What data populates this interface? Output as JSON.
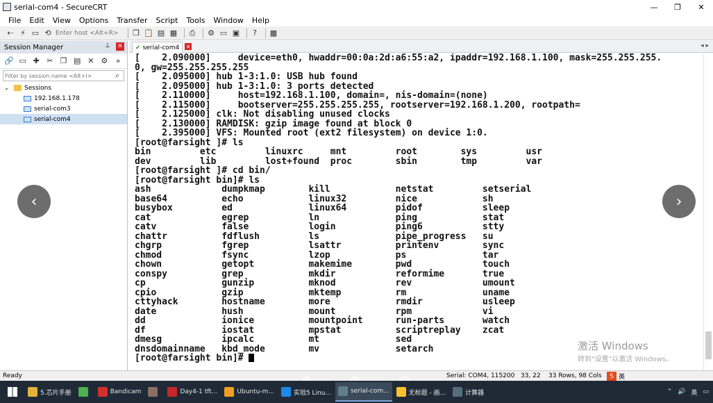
{
  "window": {
    "title": "serial-com4 - SecureCRT",
    "controls": [
      "—",
      "❐",
      "✕"
    ]
  },
  "menu": [
    "File",
    "Edit",
    "View",
    "Options",
    "Transfer",
    "Script",
    "Tools",
    "Window",
    "Help"
  ],
  "toolbar": {
    "host_placeholder": "Enter host <Alt+R>"
  },
  "session_manager": {
    "title": "Session Manager",
    "pin": "ᵽ",
    "filter_placeholder": "Filter by session name <Alt+I>",
    "root": "Sessions",
    "items": [
      {
        "label": "192.168.1.178",
        "selected": false
      },
      {
        "label": "serial-com3",
        "selected": false
      },
      {
        "label": "serial-com4",
        "selected": true
      }
    ]
  },
  "tab": {
    "label": "serial-com4"
  },
  "terminal": {
    "lines": [
      "[    2.090000]     device=eth0, hwaddr=00:0a:2d:a6:55:a2, ipaddr=192.168.1.100, mask=255.255.255.",
      "0, gw=255.255.255.255",
      "[    2.095000] hub 1-3:1.0: USB hub found",
      "[    2.095000] hub 1-3:1.0: 3 ports detected",
      "[    2.110000]     host=192.168.1.100, domain=, nis-domain=(none)",
      "[    2.115000]     bootserver=255.255.255.255, rootserver=192.168.1.200, rootpath=",
      "[    2.125000] clk: Not disabling unused clocks",
      "[    2.130000] RAMDISK: gzip image found at block 0",
      "[    2.395000] VFS: Mounted root (ext2 filesystem) on device 1:0.",
      "[root@farsight ]# ls",
      "bin         etc         linuxrc     mnt         root        sys         usr",
      "dev         lib         lost+found  proc        sbin        tmp         var",
      "[root@farsight ]# cd bin/",
      "[root@farsight bin]# ls",
      "ash             dumpkmap        kill            netstat         setserial",
      "base64          echo            linux32         nice            sh",
      "busybox         ed              linux64         pidof           sleep",
      "cat             egrep           ln              ping            stat",
      "catv            false           login           ping6           stty",
      "chattr          fdflush         ls              pipe_progress   su",
      "chgrp           fgrep           lsattr          printenv        sync",
      "chmod           fsync           lzop            ps              tar",
      "chown           getopt          makemime        pwd             touch",
      "conspy          grep            mkdir           reformime       true",
      "cp              gunzip          mknod           rev             umount",
      "cpio            gzip            mktemp          rm              uname",
      "cttyhack        hostname        more            rmdir           usleep",
      "date            hush            mount           rpm             vi",
      "dd              ionice          mountpoint      run-parts       watch",
      "df              iostat          mpstat          scriptreplay    zcat",
      "dmesg           ipcalc          mt              sed",
      "dnsdomainname   kbd_mode        mv              setarch",
      "[root@farsight bin]# "
    ]
  },
  "watermark": {
    "line1": "激活 Windows",
    "line2": "转到\"设置\"以激活 Windows。"
  },
  "status": {
    "ready": "Ready",
    "serial": "Serial: COM4, 115200",
    "position": "33,  22",
    "size": "33 Rows, 98 Cols",
    "ime": "英"
  },
  "taskbar": {
    "items": [
      {
        "label": "5.芯片手册",
        "color": "#e2b13c",
        "active": false
      },
      {
        "label": "",
        "color": "#4caf50",
        "active": false
      },
      {
        "label": "Bandicam",
        "color": "#d32f2f",
        "active": false
      },
      {
        "label": "",
        "color": "#8d6e63",
        "active": false
      },
      {
        "label": "Day4-1 tft...",
        "color": "#c62828",
        "active": false
      },
      {
        "label": "Ubuntu-m...",
        "color": "#f0a020",
        "active": false
      },
      {
        "label": "实验5 Linu...",
        "color": "#1e88e5",
        "active": false
      },
      {
        "label": "serial-com...",
        "color": "#607d8b",
        "active": true
      },
      {
        "label": "无标题 - 画...",
        "color": "#fbc02d",
        "active": false
      },
      {
        "label": "计算器",
        "color": "#546e7a",
        "active": false
      }
    ],
    "tray_text": "英"
  }
}
